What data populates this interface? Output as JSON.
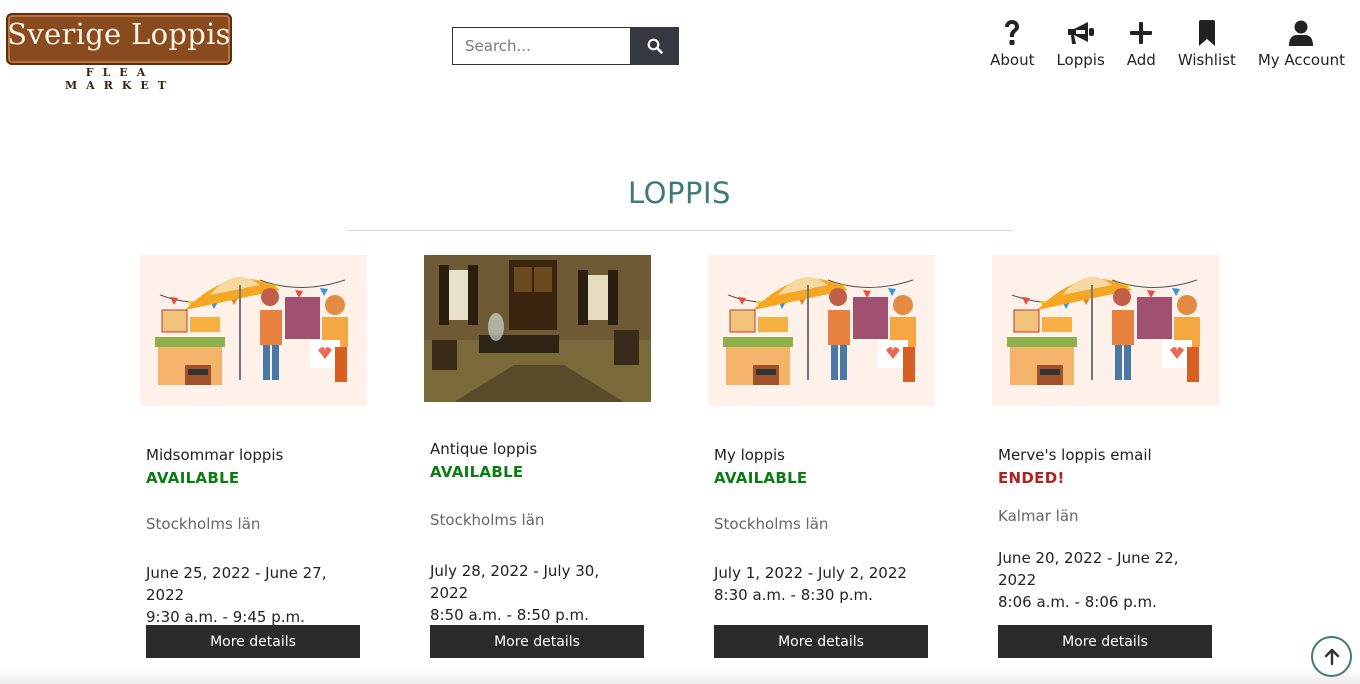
{
  "logo": {
    "title": "Sverige Loppis",
    "subtitle": "FLEA MARKET"
  },
  "search": {
    "placeholder": "Search..."
  },
  "nav": {
    "about": "About",
    "loppis": "Loppis",
    "add": "Add",
    "wishlist": "Wishlist",
    "account": "My Account"
  },
  "section": {
    "heading": "LOPPIS"
  },
  "cards": [
    {
      "title": "Midsommar loppis",
      "status": "AVAILABLE",
      "region": "Stockholms län",
      "dates_line1": "June 25, 2022 - June 27, 2022",
      "dates_line2": "9:30 a.m. - 9:45 p.m.",
      "button": "More details"
    },
    {
      "title": "Antique loppis",
      "status": "AVAILABLE",
      "region": "Stockholms län",
      "dates_line1": "July 28, 2022 - July 30, 2022",
      "dates_line2": "8:50 a.m. - 8:50 p.m.",
      "button": "More details"
    },
    {
      "title": "My loppis",
      "status": "AVAILABLE",
      "region": "Stockholms län",
      "dates_line1": "July 1, 2022 - July 2, 2022",
      "dates_line2": "8:30 a.m. - 8:30 p.m.",
      "button": "More details"
    },
    {
      "title": "Merve's loppis email",
      "status": "ENDED!",
      "region": "Kalmar län",
      "dates_line1": "June 20, 2022 - June 22, 2022",
      "dates_line2": "8:06 a.m. - 8:06 p.m.",
      "button": "More details"
    }
  ],
  "colors": {
    "accent": "#3f7a7a",
    "available": "#0a7d12",
    "ended": "#b02323",
    "button": "#2b2b2b"
  }
}
